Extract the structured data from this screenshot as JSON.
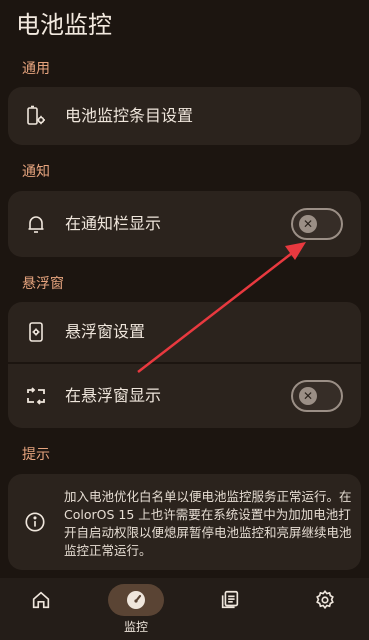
{
  "app": {
    "title": "电池监控"
  },
  "sections": {
    "general": "通用",
    "notify": "通知",
    "floating": "悬浮窗",
    "tips": "提示"
  },
  "rows": {
    "battery_items": "电池监控条目设置",
    "show_in_notification": "在通知栏显示",
    "floating_settings": "悬浮窗设置",
    "show_in_floating": "在悬浮窗显示"
  },
  "toggles": {
    "show_in_notification": false,
    "show_in_floating": false
  },
  "tip": {
    "text": "加入电池优化白名单以便电池监控服务正常运行。在 ColorOS 15 上也许需要在系统设置中为加加电池打开自启动权限以便熄屏暂停电池监控和亮屏继续电池监控正常运行。"
  },
  "nav": {
    "active_label": "监控"
  },
  "icons": [
    "battery-settings-icon",
    "bell-icon",
    "floating-window-icon",
    "swap-window-icon",
    "info-icon",
    "home-icon",
    "speedometer-icon",
    "list-icon",
    "gear-icon",
    "close-icon"
  ],
  "colors": {
    "accent": "#e6a47e",
    "background": "#1c1510",
    "card": "#2b231d",
    "arrow": "#e8393f"
  }
}
